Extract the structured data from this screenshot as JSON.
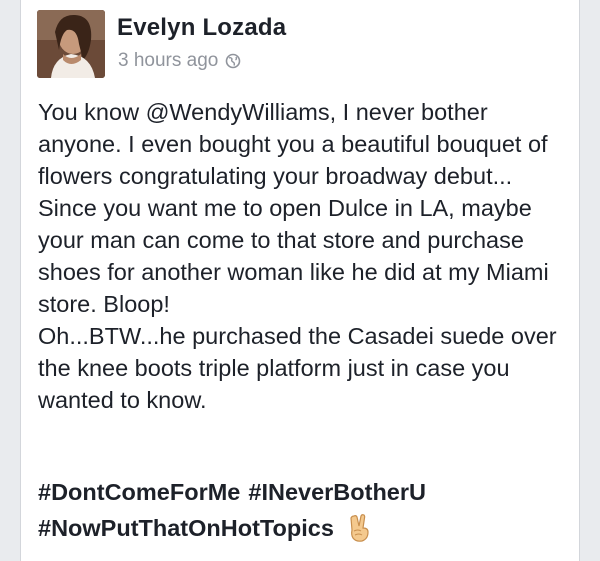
{
  "post": {
    "author": "Evelyn Lozada",
    "timestamp": "3 hours ago",
    "privacy_icon": "globe-icon",
    "avatar_icon": "profile-photo",
    "body": {
      "p1": "You know @WendyWilliams, I never bother anyone. I even bought you a beautiful bouquet of flowers congratulating your broadway debut...",
      "p2": "Since you want me to open Dulce in LA, maybe your man can come to that store and purchase shoes for another woman like he did at my Miami store. Bloop!",
      "p3": "Oh...BTW...he purchased the Casadei suede over the knee boots triple platform just in case you wanted to know."
    },
    "hashtags": [
      "#DontComeForMe",
      "#INeverBotherU",
      "#NowPutThatOnHotTopics"
    ],
    "emoji_icon": "victory-hand-icon"
  }
}
